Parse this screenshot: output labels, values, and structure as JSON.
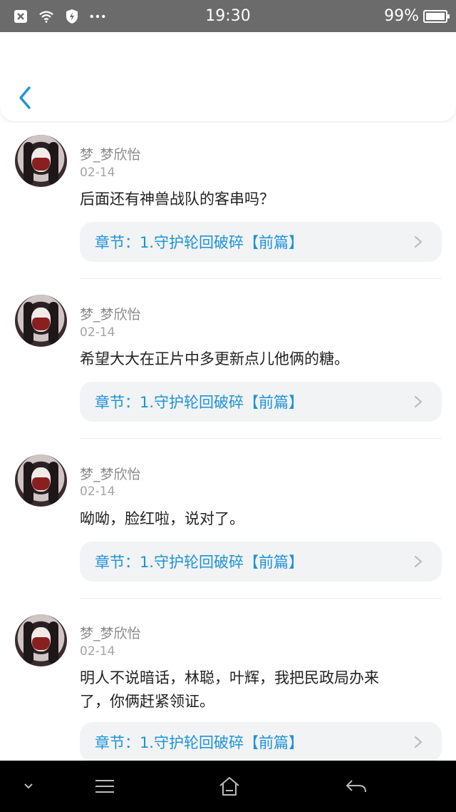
{
  "status_bar": {
    "time": "19:30",
    "battery_percent": "99%",
    "battery_level": 0.99,
    "icons": [
      "close-notification-icon",
      "wifi-icon",
      "shield-icon",
      "more-dots-icon"
    ]
  },
  "header": {
    "back_icon": "chevron-left-icon",
    "accent_color": "#1e93d8"
  },
  "comments": [
    {
      "username": "梦_梦欣怡",
      "date": "02-14",
      "text": "后面还有神兽战队的客串吗？",
      "chapter": "章节：1.守护轮回破碎【前篇】"
    },
    {
      "username": "梦_梦欣怡",
      "date": "02-14",
      "text": "希望大大在正片中多更新点儿他俩的糖。",
      "chapter": "章节：1.守护轮回破碎【前篇】"
    },
    {
      "username": "梦_梦欣怡",
      "date": "02-14",
      "text": "呦呦，脸红啦，说对了。",
      "chapter": "章节：1.守护轮回破碎【前篇】"
    },
    {
      "username": "梦_梦欣怡",
      "date": "02-14",
      "text_line1": "明人不说暗话，林聪，叶辉，我把民政局办来",
      "text_line2": "了，你俩赶紧领证。",
      "chapter": "章节：1.守护轮回破碎【前篇】"
    }
  ],
  "nav_bar": {
    "icons": [
      "collapse-chevron-icon",
      "menu-icon",
      "home-icon",
      "back-arrow-icon"
    ]
  }
}
